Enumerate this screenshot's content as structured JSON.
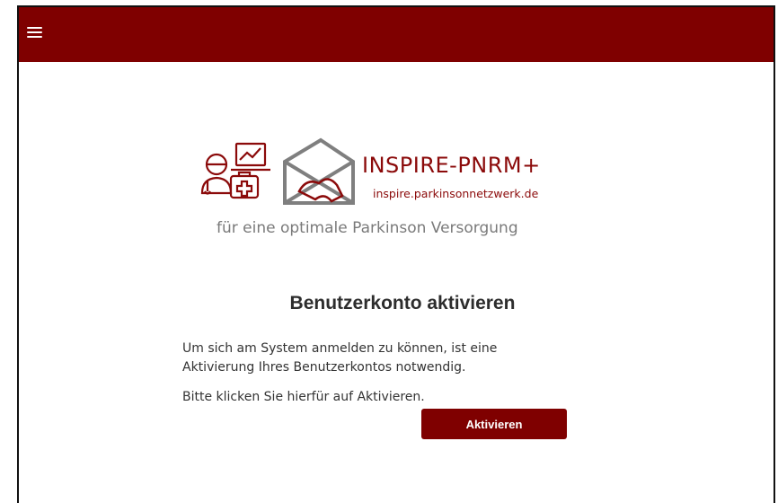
{
  "header": {
    "menu_icon": "hamburger-menu-icon",
    "bg_color": "#7f0000"
  },
  "logo": {
    "title": "INSPIRE-PNRM+",
    "url": "inspire.parkinsonnetzwerk.de",
    "tagline": "für eine optimale Parkinson Versorgung",
    "brand_color": "#8b0a0a",
    "icons": [
      "doctor-icon",
      "monitor-chart-icon",
      "medical-kit-icon",
      "map-envelope-icon"
    ]
  },
  "activation": {
    "title": "Benutzerkonto aktivieren",
    "message": "Um sich am System anmelden zu können, ist eine Aktivierung Ihres Benutzerkontos notwendig.",
    "instruction": "Bitte klicken Sie hierfür auf Aktivieren.",
    "button_label": "Aktivieren"
  }
}
